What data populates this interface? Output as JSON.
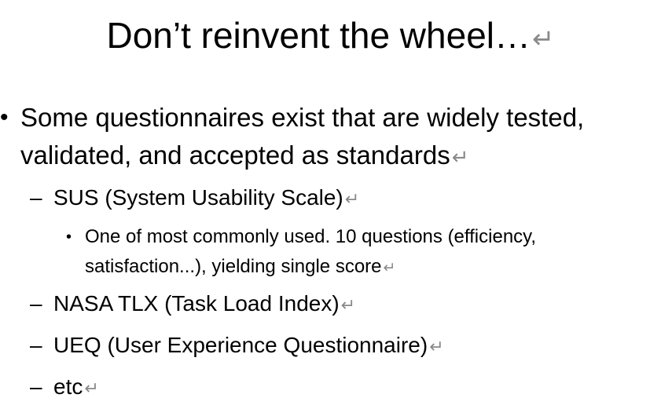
{
  "slide": {
    "title": "Don’t reinvent the wheel…",
    "return_mark": "↵",
    "bullet_char": "•",
    "dash_char": "–",
    "point": {
      "text": "Some questionnaires exist that are widely tested, validated, and accepted as standards",
      "subpoints": [
        {
          "text": "SUS (System Usability Scale)",
          "detail": "One of most commonly used. 10 questions (efficiency, satisfaction...), yielding single score"
        },
        {
          "text": "NASA TLX (Task Load Index)"
        },
        {
          "text": "UEQ (User Experience Questionnaire)"
        },
        {
          "text": "etc"
        }
      ]
    }
  }
}
